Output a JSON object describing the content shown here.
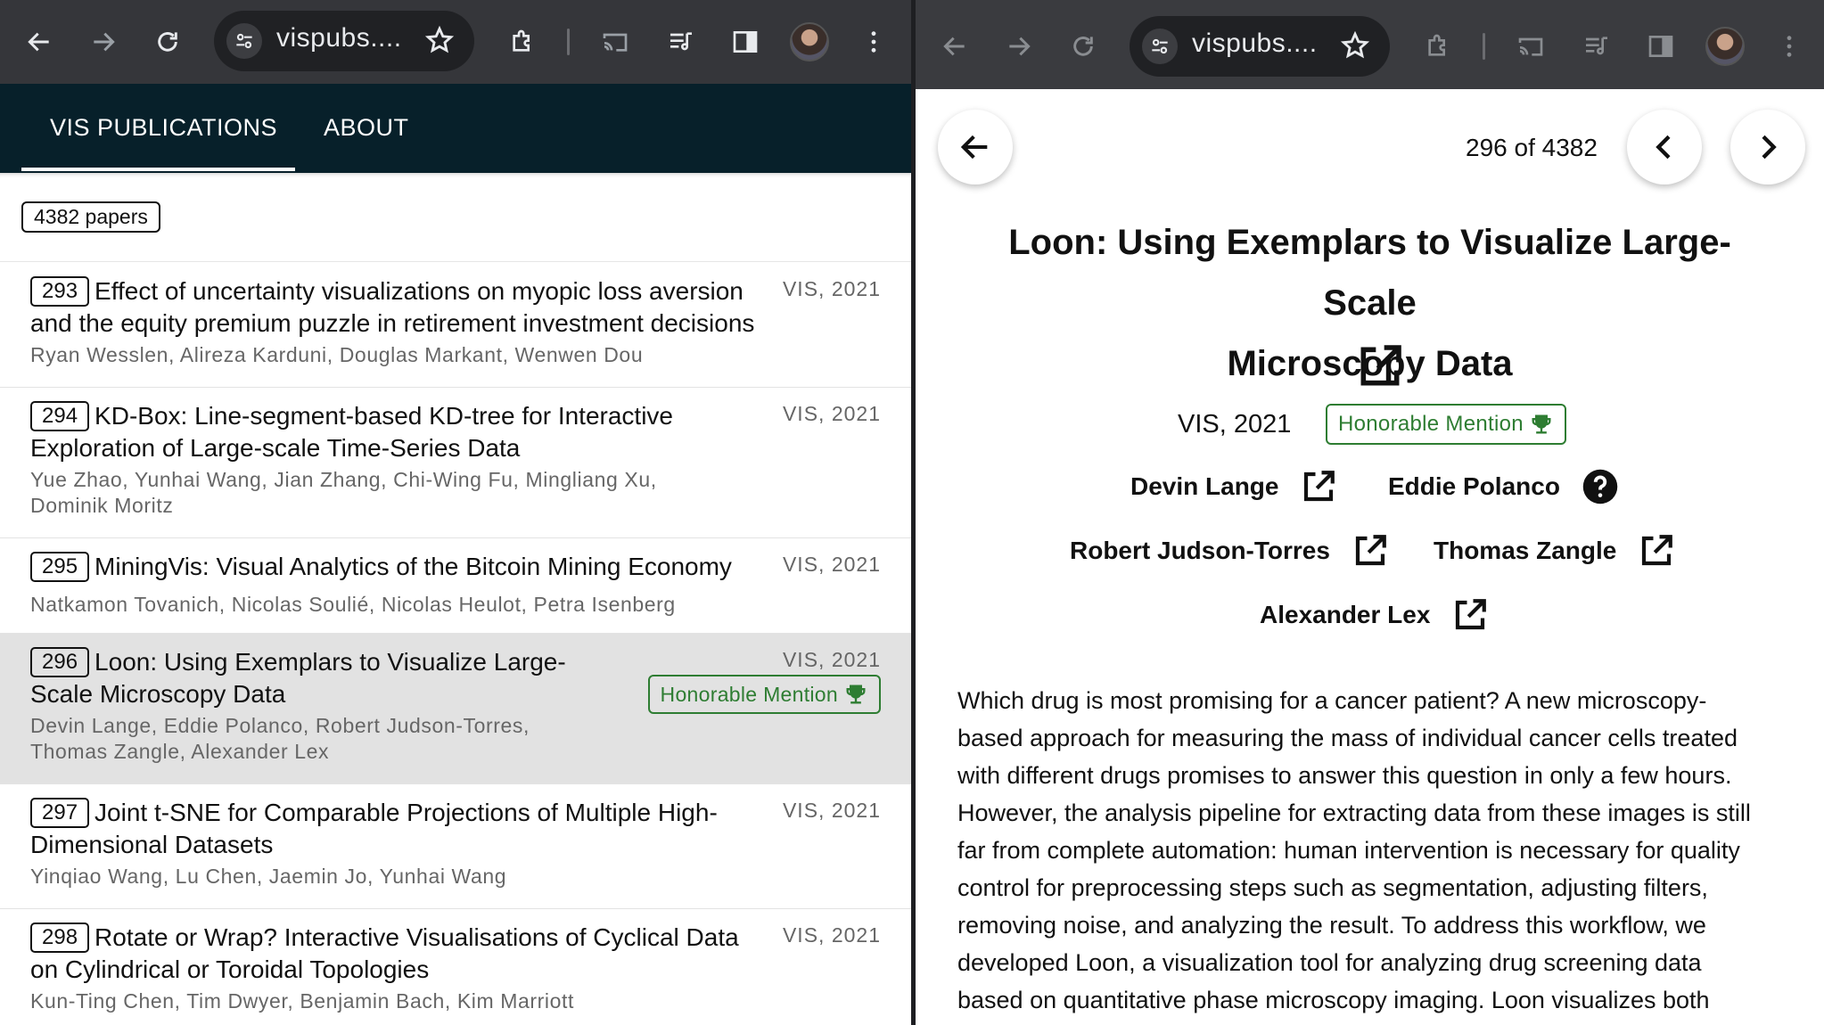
{
  "left_window": {
    "url": "vispubs....",
    "nav_tabs": [
      "VIS PUBLICATIONS",
      "ABOUT"
    ],
    "paper_count": "4382 papers",
    "papers": [
      {
        "index": "293",
        "title_line1": "Effect of uncertainty visualizations on myopic loss aversion",
        "title_line2": "and the equity premium puzzle in retirement investment decisions",
        "authors_line1": "Ryan Wesslen, Alireza Karduni, Douglas Markant, Wenwen Dou",
        "authors_line2": "",
        "venue": "VIS, 2021",
        "award": ""
      },
      {
        "index": "294",
        "title_line1": "KD-Box: Line-segment-based KD-tree for Interactive",
        "title_line2": "Exploration of Large-scale Time-Series Data",
        "authors_line1": "Yue Zhao, Yunhai Wang, Jian Zhang, Chi-Wing Fu, Mingliang Xu,",
        "authors_line2": "Dominik Moritz",
        "venue": "VIS, 2021",
        "award": ""
      },
      {
        "index": "295",
        "title_line1": "MiningVis: Visual Analytics of the Bitcoin Mining Economy",
        "title_line2": "",
        "authors_line1": "Natkamon Tovanich, Nicolas Soulié, Nicolas Heulot, Petra Isenberg",
        "authors_line2": "",
        "venue": "VIS, 2021",
        "award": ""
      },
      {
        "index": "296",
        "title_line1": "Loon: Using Exemplars to Visualize Large-",
        "title_line2": "Scale Microscopy Data",
        "authors_line1": "Devin Lange, Eddie Polanco, Robert Judson-Torres,",
        "authors_line2": "Thomas Zangle, Alexander Lex",
        "venue": "VIS, 2021",
        "award": "Honorable Mention"
      },
      {
        "index": "297",
        "title_line1": "Joint t-SNE for Comparable Projections of Multiple High-",
        "title_line2": "Dimensional Datasets",
        "authors_line1": "Yinqiao Wang, Lu Chen, Jaemin Jo, Yunhai Wang",
        "authors_line2": "",
        "venue": "VIS, 2021",
        "award": ""
      },
      {
        "index": "298",
        "title_line1": "Rotate or Wrap? Interactive Visualisations of Cyclical Data",
        "title_line2": "on Cylindrical or Toroidal Topologies",
        "authors_line1": "Kun-Ting Chen, Tim Dwyer, Benjamin Bach, Kim Marriott",
        "authors_line2": "",
        "venue": "VIS, 2021",
        "award": ""
      }
    ]
  },
  "right_window": {
    "url": "vispubs....",
    "pager": "296 of 4382",
    "title_line1": "Loon: Using Exemplars to Visualize Large-Scale",
    "title_line2": "Microscopy Data",
    "venue": "VIS, 2021",
    "award": "Honorable Mention",
    "authors": [
      "Devin Lange",
      "Eddie Polanco",
      "Robert Judson-Torres",
      "Thomas Zangle",
      "Alexander Lex"
    ],
    "abstract_lines": [
      "Which drug is most promising for a cancer patient? A new microscopy-",
      "based approach for measuring the mass of individual cancer cells treated",
      "with different drugs promises to answer this question in only a few hours.",
      "However, the analysis pipeline for extracting data from these images is still",
      "far from complete automation: human intervention is necessary for quality",
      "control for preprocessing steps such as segmentation, adjusting filters,",
      "removing noise, and analyzing the result. To address this workflow, we",
      "developed Loon, a visualization tool for analyzing drug screening data",
      "based on quantitative phase microscopy imaging. Loon visualizes both"
    ]
  },
  "colors": {
    "toolbar": "#35363a",
    "appbar": "#07202a",
    "award_green": "#2e7d32",
    "selected_row": "#e2e2e2"
  }
}
